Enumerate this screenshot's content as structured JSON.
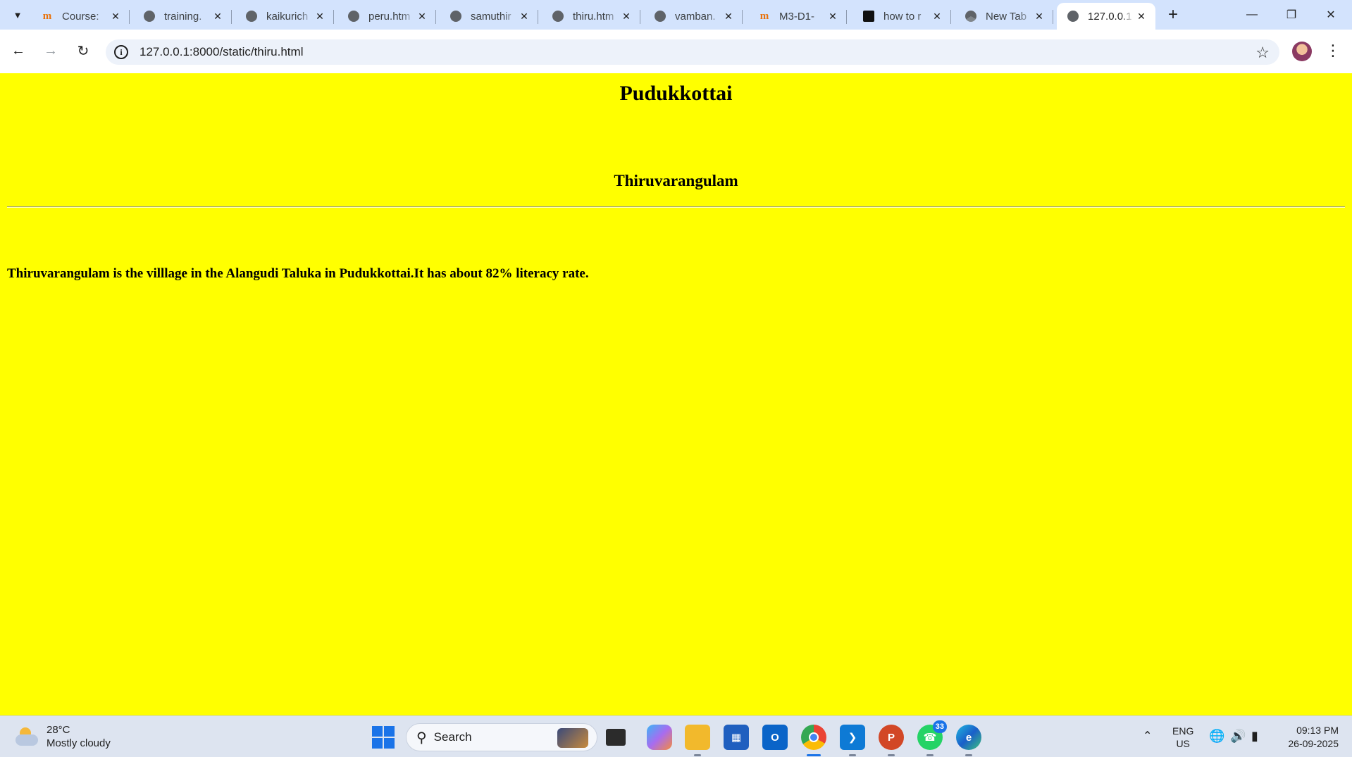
{
  "browser": {
    "tabs": [
      {
        "title": "Course:",
        "favicon": "orange-m-icon"
      },
      {
        "title": "training.",
        "favicon": "globe-icon"
      },
      {
        "title": "kaikurich",
        "favicon": "globe-icon"
      },
      {
        "title": "peru.htm",
        "favicon": "globe-icon"
      },
      {
        "title": "samuthir",
        "favicon": "globe-icon"
      },
      {
        "title": "thiru.htm",
        "favicon": "globe-icon"
      },
      {
        "title": "vamban.",
        "favicon": "globe-icon"
      },
      {
        "title": "M3-D1-",
        "favicon": "orange-m-icon"
      },
      {
        "title": "how to r",
        "favicon": "black-emblem-icon"
      },
      {
        "title": "New Tab",
        "favicon": "chrome-icon"
      },
      {
        "title": "127.0.0.1",
        "favicon": "globe-icon",
        "active": true
      }
    ],
    "new_tab_glyph": "+",
    "url": "127.0.0.1:8000/static/thiru.html"
  },
  "page": {
    "heading": "Pudukkottai",
    "subheading": "Thiruvarangulam",
    "paragraph": "Thiruvarangulam is the villlage in the Alangudi Taluka in Pudukkottai.It has about 82% literacy rate.",
    "background_color": "#ffff00"
  },
  "taskbar": {
    "weather_temp": "28°C",
    "weather_desc": "Mostly cloudy",
    "search_label": "Search",
    "whatsapp_badge": "33",
    "lang_line1": "ENG",
    "lang_line2": "US",
    "time": "09:13 PM",
    "date": "26-09-2025"
  }
}
